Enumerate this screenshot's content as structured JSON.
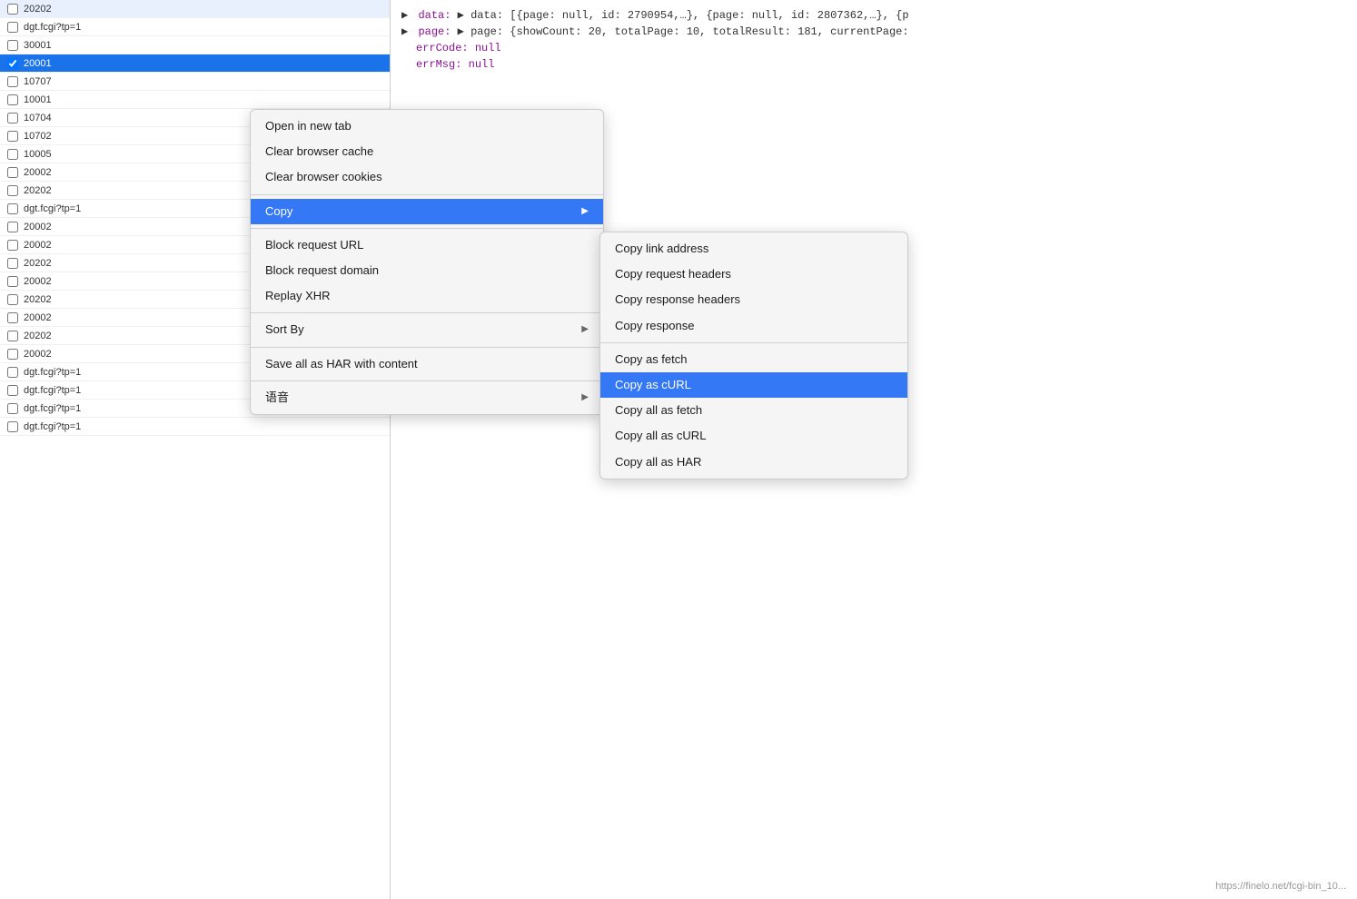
{
  "networkPanel": {
    "items": [
      {
        "id": "item-20202-1",
        "name": "20202",
        "selected": false
      },
      {
        "id": "item-dgt1",
        "name": "dgt.fcgi?tp=1",
        "selected": false
      },
      {
        "id": "item-30001",
        "name": "30001",
        "selected": false
      },
      {
        "id": "item-20001",
        "name": "20001",
        "selected": true
      },
      {
        "id": "item-10707",
        "name": "10707",
        "selected": false
      },
      {
        "id": "item-10001",
        "name": "10001",
        "selected": false
      },
      {
        "id": "item-10704",
        "name": "10704",
        "selected": false
      },
      {
        "id": "item-10702",
        "name": "10702",
        "selected": false
      },
      {
        "id": "item-10005",
        "name": "10005",
        "selected": false
      },
      {
        "id": "item-20002-1",
        "name": "20002",
        "selected": false
      },
      {
        "id": "item-20202-2",
        "name": "20202",
        "selected": false
      },
      {
        "id": "item-dgt2",
        "name": "dgt.fcgi?tp=1",
        "selected": false
      },
      {
        "id": "item-20002-2",
        "name": "20002",
        "selected": false
      },
      {
        "id": "item-20002-3",
        "name": "20002",
        "selected": false
      },
      {
        "id": "item-20202-3",
        "name": "20202",
        "selected": false
      },
      {
        "id": "item-20002-4",
        "name": "20002",
        "selected": false
      },
      {
        "id": "item-20202-4",
        "name": "20202",
        "selected": false
      },
      {
        "id": "item-20002-5",
        "name": "20002",
        "selected": false
      },
      {
        "id": "item-20202-5",
        "name": "20202",
        "selected": false
      },
      {
        "id": "item-20002-6",
        "name": "20002",
        "selected": false
      },
      {
        "id": "item-dgt3",
        "name": "dgt.fcgi?tp=1",
        "selected": false
      },
      {
        "id": "item-dgt4",
        "name": "dgt.fcgi?tp=1",
        "selected": false
      },
      {
        "id": "item-dgt5",
        "name": "dgt.fcgi?tp=1",
        "selected": false
      },
      {
        "id": "item-dgt6",
        "name": "dgt.fcgi?tp=1",
        "selected": false
      }
    ]
  },
  "responsePanel": {
    "line1": "▶ data: [{page: null, id: 2790954,…}, {page: null, id: 2807362,…}, {p",
    "line2": "▶ page: {showCount: 20, totalPage: 10, totalResult: 181, currentPage:",
    "line3_key": "errCode:",
    "line3_val": " null",
    "line4_key": "errMsg:",
    "line4_val": " null"
  },
  "contextMenu": {
    "items": [
      {
        "id": "open-new-tab",
        "label": "Open in new tab",
        "hasArrow": false,
        "separator_after": false
      },
      {
        "id": "clear-cache",
        "label": "Clear browser cache",
        "hasArrow": false,
        "separator_after": false
      },
      {
        "id": "clear-cookies",
        "label": "Clear browser cookies",
        "hasArrow": false,
        "separator_after": true
      },
      {
        "id": "copy",
        "label": "Copy",
        "hasArrow": true,
        "active": true,
        "separator_after": true
      },
      {
        "id": "block-url",
        "label": "Block request URL",
        "hasArrow": false,
        "separator_after": false
      },
      {
        "id": "block-domain",
        "label": "Block request domain",
        "hasArrow": false,
        "separator_after": false
      },
      {
        "id": "replay-xhr",
        "label": "Replay XHR",
        "hasArrow": false,
        "separator_after": true
      },
      {
        "id": "sort-by",
        "label": "Sort By",
        "hasArrow": true,
        "separator_after": true
      },
      {
        "id": "save-har",
        "label": "Save all as HAR with content",
        "hasArrow": false,
        "separator_after": true
      },
      {
        "id": "language",
        "label": "语音",
        "hasArrow": true,
        "separator_after": false
      }
    ]
  },
  "submenu": {
    "items": [
      {
        "id": "copy-link-address",
        "label": "Copy link address",
        "highlighted": false
      },
      {
        "id": "copy-request-headers",
        "label": "Copy request headers",
        "highlighted": false
      },
      {
        "id": "copy-response-headers",
        "label": "Copy response headers",
        "highlighted": false
      },
      {
        "id": "copy-response",
        "label": "Copy response",
        "highlighted": false
      },
      {
        "id": "sep1",
        "separator": true
      },
      {
        "id": "copy-as-fetch",
        "label": "Copy as fetch",
        "highlighted": false
      },
      {
        "id": "copy-as-curl",
        "label": "Copy as cURL",
        "highlighted": true
      },
      {
        "id": "copy-all-as-fetch",
        "label": "Copy all as fetch",
        "highlighted": false
      },
      {
        "id": "copy-all-as-curl",
        "label": "Copy all as cURL",
        "highlighted": false
      },
      {
        "id": "copy-all-as-har",
        "label": "Copy all as HAR",
        "highlighted": false
      }
    ]
  },
  "statusBar": {
    "text": "https://finelo.net/fcgi-bin_10..."
  }
}
